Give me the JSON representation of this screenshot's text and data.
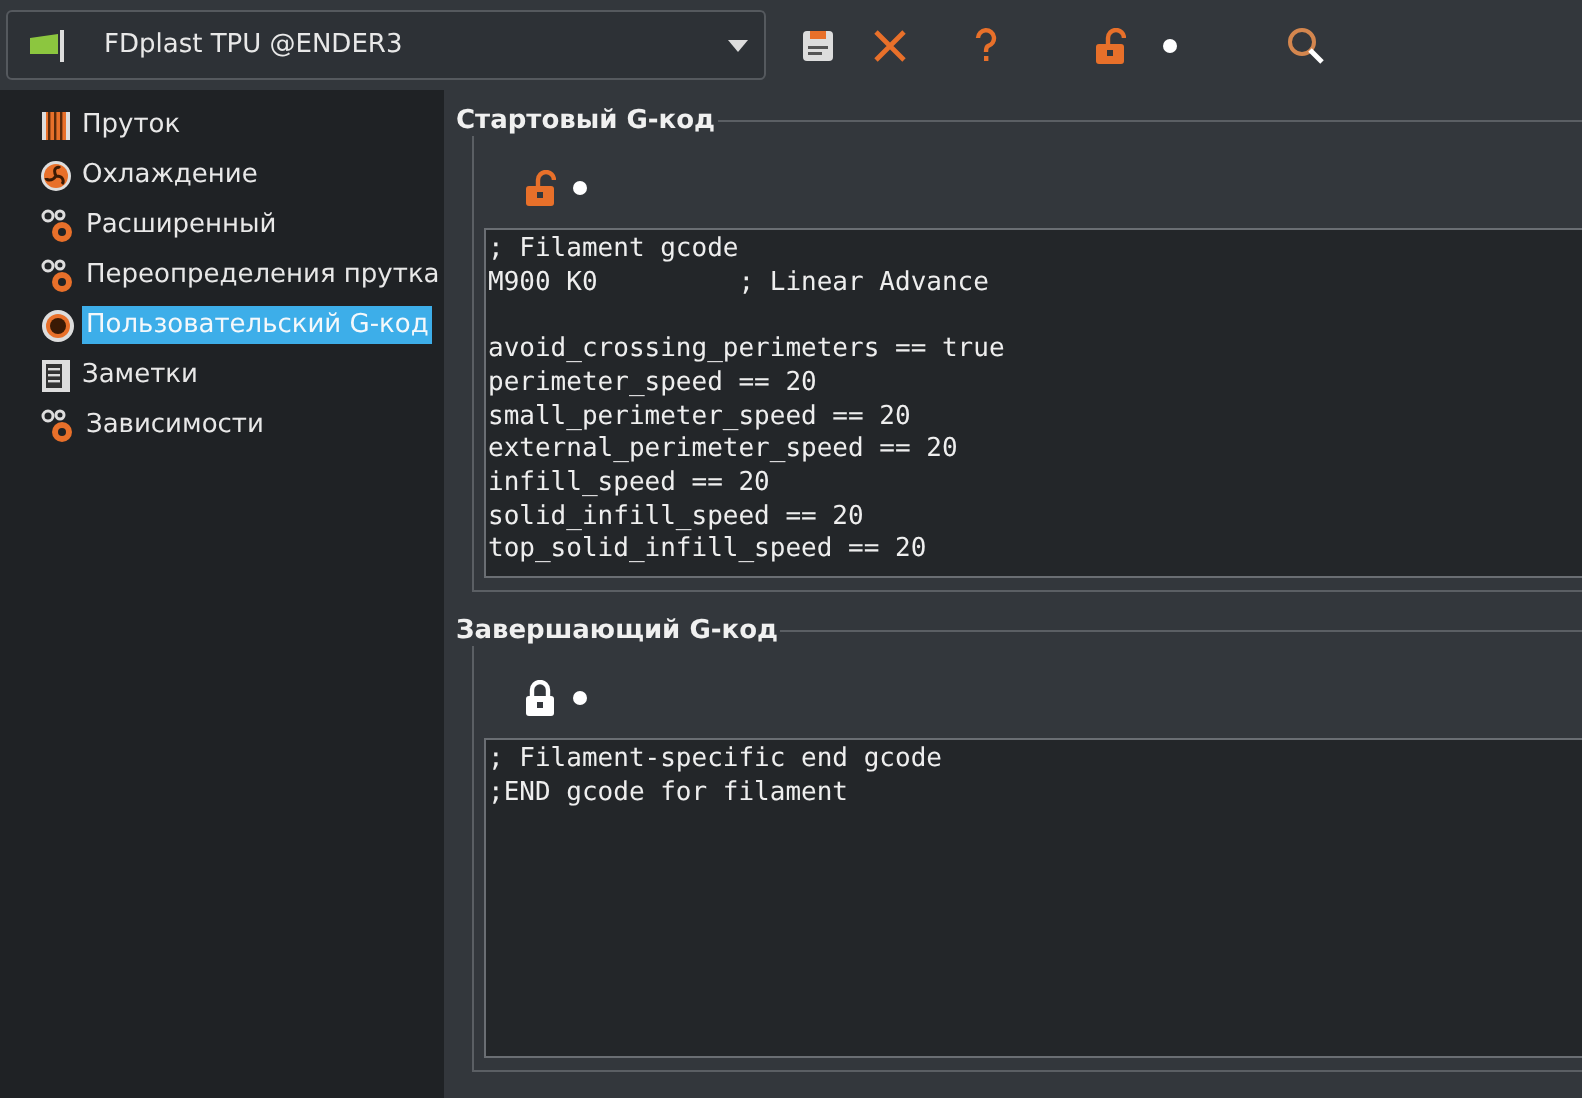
{
  "preset": {
    "name": "FDplast TPU @ENDER3"
  },
  "toolbar": {
    "locked": false
  },
  "sidebar": {
    "items": [
      {
        "label": "Пруток",
        "kind": "filament",
        "selected": false
      },
      {
        "label": "Охлаждение",
        "kind": "fan",
        "selected": false
      },
      {
        "label": "Расширенный",
        "kind": "gears",
        "selected": false
      },
      {
        "label": "Переопределения прутка",
        "kind": "gears",
        "selected": false
      },
      {
        "label": "Пользовательский G-код",
        "kind": "cog",
        "selected": true
      },
      {
        "label": "Заметки",
        "kind": "notes",
        "selected": false
      },
      {
        "label": "Зависимости",
        "kind": "gears",
        "selected": false
      }
    ]
  },
  "sections": [
    {
      "title": "Стартовый G-код",
      "locked": false,
      "code": "; Filament gcode\nM900 K0         ; Linear Advance\n\navoid_crossing_perimeters == true\nperimeter_speed == 20\nsmall_perimeter_speed == 20\nexternal_perimeter_speed == 20\ninfill_speed == 20\nsolid_infill_speed == 20\ntop_solid_infill_speed == 20"
    },
    {
      "title": "Завершающий G-код",
      "locked": true,
      "code": "; Filament-specific end gcode\n;END gcode for filament"
    }
  ]
}
